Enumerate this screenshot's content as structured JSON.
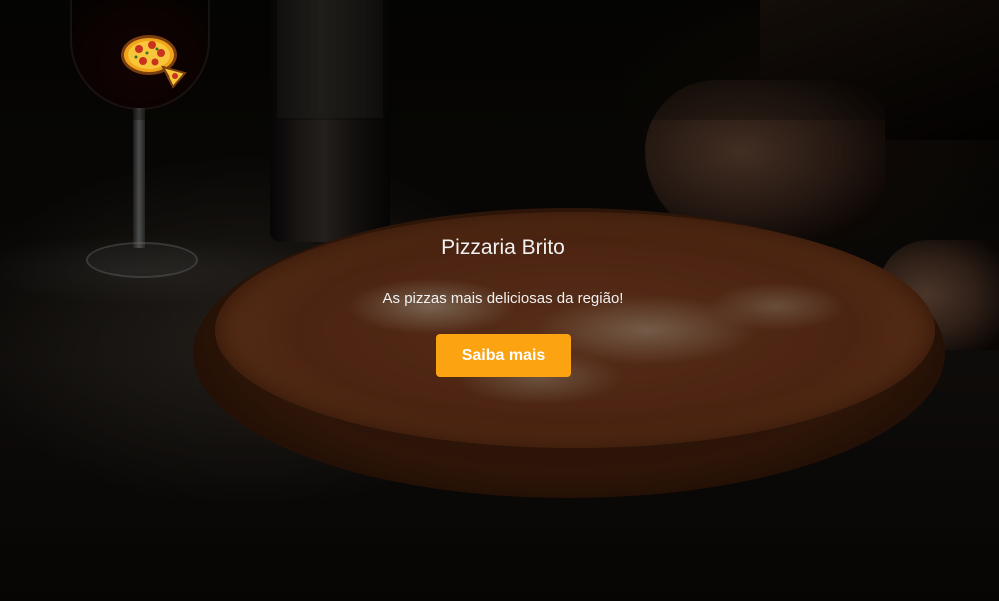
{
  "hero": {
    "title": "Pizzaria Brito",
    "subtitle": "As pizzas mais deliciosas da região!",
    "cta_label": "Saiba mais"
  },
  "logo": {
    "icon": "pizza-logo-icon"
  },
  "colors": {
    "accent": "#fca311",
    "text": "#f1f1f1",
    "button_text": "#ffffff"
  }
}
